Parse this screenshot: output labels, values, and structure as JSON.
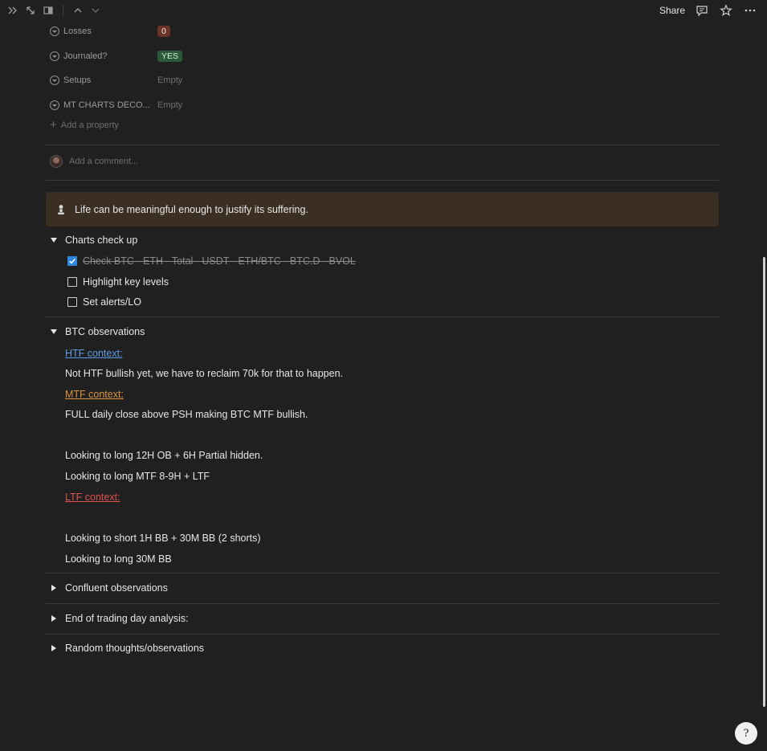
{
  "topbar": {
    "share_label": "Share",
    "icons": [
      "expand-sidebar-icon",
      "resize-icon",
      "layout-icon",
      "chevron-up-icon",
      "chevron-down-icon",
      "comment-icon",
      "star-icon",
      "more-icon"
    ]
  },
  "properties": [
    {
      "name": "Losses",
      "value": "0",
      "type": "badge",
      "color": "#6b3227"
    },
    {
      "name": "Journaled?",
      "value": "YES",
      "type": "badge",
      "color": "#2b5a3b"
    },
    {
      "name": "Setups",
      "value": "Empty",
      "type": "empty"
    },
    {
      "name": "MT CHARTS DECO...",
      "value": "Empty",
      "type": "empty"
    }
  ],
  "add_property_label": "Add a property",
  "comment": {
    "placeholder": "Add a comment..."
  },
  "callout": {
    "text": "Life can be meaningful enough to justify its suffering.",
    "bg": "#3a2f22"
  },
  "charts_check": {
    "title": "Charts check up",
    "items": [
      {
        "label": "Check BTC - ETH - Total - USDT - ETH/BTC - BTC.D - BVOL",
        "checked": true
      },
      {
        "label": "Highlight key levels",
        "checked": false
      },
      {
        "label": "Set alerts/LO",
        "checked": false
      }
    ]
  },
  "btc_observations": {
    "title": "BTC observations",
    "htf_label": "HTF context:",
    "htf_text": "Not HTF bullish yet, we have to reclaim 70k for that to happen.",
    "mtf_label": "MTF context:",
    "mtf_text": "FULL daily close above PSH making BTC MTF bullish.",
    "mtf_line2": "Looking to long 12H OB + 6H Partial hidden.",
    "mtf_line3": "Looking to long MTF 8-9H + LTF",
    "ltf_label": "LTF context:",
    "ltf_line1": "Looking to short 1H BB + 30M BB (2 shorts)",
    "ltf_line2": "Looking to long 30M BB"
  },
  "collapsed_sections": [
    {
      "title": "Confluent observations"
    },
    {
      "title": "End of trading day analysis:"
    },
    {
      "title": "Random thoughts/observations"
    }
  ],
  "help_label": "?",
  "colors": {
    "background": "#202020",
    "htf": "#5a9ce6",
    "mtf": "#d9923f",
    "ltf": "#e0524d",
    "checkbox": "#2e86de"
  }
}
